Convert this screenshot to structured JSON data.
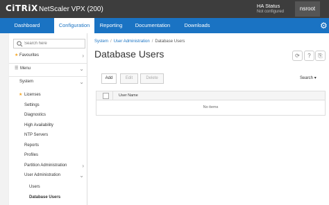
{
  "app": {
    "logo": "CiTRiX",
    "product": "NetScaler VPX (200)"
  },
  "ha": {
    "title": "HA Status",
    "status": "Not configured"
  },
  "user": {
    "name": "nsroot"
  },
  "nav": {
    "tabs": [
      {
        "label": "Dashboard"
      },
      {
        "label": "Configuration"
      },
      {
        "label": "Reporting"
      },
      {
        "label": "Documentation"
      },
      {
        "label": "Downloads"
      }
    ]
  },
  "sidebar": {
    "search_placeholder": "Search here",
    "items": [
      {
        "label": "Favourites"
      },
      {
        "label": "Menu"
      },
      {
        "label": "System"
      },
      {
        "label": "Licenses"
      },
      {
        "label": "Settings"
      },
      {
        "label": "Diagnostics"
      },
      {
        "label": "High Availability"
      },
      {
        "label": "NTP Servers"
      },
      {
        "label": "Reports"
      },
      {
        "label": "Profiles"
      },
      {
        "label": "Partition Administration"
      },
      {
        "label": "User Administration"
      },
      {
        "label": "Users"
      },
      {
        "label": "Database Users"
      }
    ]
  },
  "breadcrumb": {
    "items": [
      "System",
      "User Administration",
      "Database Users"
    ]
  },
  "page": {
    "title": "Database Users"
  },
  "toolbar": {
    "add": "Add",
    "edit": "Edit",
    "delete": "Delete",
    "search": "Search"
  },
  "table": {
    "columns": [
      "User Name"
    ],
    "empty_text": "No items"
  },
  "colors": {
    "accent": "#1a73c3",
    "topbar": "#3d3d3d",
    "favourite_star": "#f5a623"
  }
}
